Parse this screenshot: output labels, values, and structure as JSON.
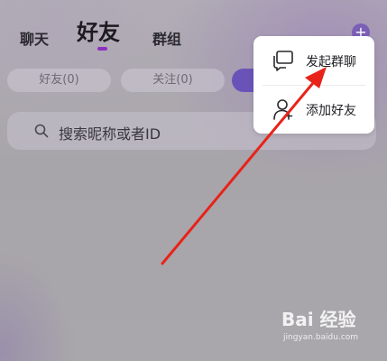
{
  "tabs": {
    "chat": "聊天",
    "friends": "好友",
    "groups": "群组"
  },
  "header": {
    "plus_icon": "plus-icon"
  },
  "filters": {
    "friends": "好友(0)",
    "follow": "关注(0)"
  },
  "search": {
    "placeholder": "搜索昵称或者ID"
  },
  "popup_menu": {
    "items": [
      {
        "label": "发起群聊",
        "icon": "group-chat-icon"
      },
      {
        "label": "添加好友",
        "icon": "add-friend-icon"
      }
    ]
  },
  "annotation": {
    "arrow_color": "#e8231a"
  },
  "watermark": {
    "logo": "Bai 经验",
    "url": "jingyan.baidu.com"
  },
  "colors": {
    "accent": "#8e2fc1",
    "plus_button": "#7b5fb5"
  }
}
